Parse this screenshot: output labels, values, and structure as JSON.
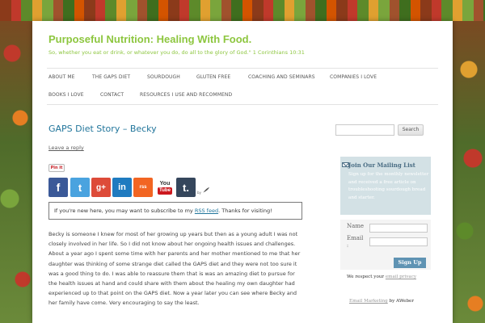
{
  "site": {
    "title": "Purposeful Nutrition: Healing With Food.",
    "description": "So, whether you eat or drink, or whatever you do, do all to the glory of God.\" 1 Corinthians 10:31"
  },
  "nav": {
    "items": [
      "ABOUT ME",
      "THE GAPS DIET",
      "SOURDOUGH",
      "GLUTEN FREE",
      "COACHING AND SEMINARS",
      "COMPANIES I LOVE",
      "BOOKS I LOVE",
      "CONTACT",
      "RESOURCES I USE AND RECOMMEND"
    ]
  },
  "post": {
    "title": "GAPS Diet Story – Becky",
    "leave_reply": "Leave a reply",
    "pinit": "Pin it",
    "notice_before": "If you're new here, you may want to subscribe to my ",
    "notice_link": "RSS feed",
    "notice_after": ". Thanks for visiting!",
    "body": "Becky is someone I knew for most of her growing up years but then as a young adult I was not closely involved in her life.   So I did not know about her ongoing health issues and challenges.  About a year ago I spent some time with her parents and her mother mentioned to me that her daughter was thinking of some strange diet called the GAPS diet and they were not too sure it was a good thing to do.  I was able to reassure them that is was an amazing diet to pursue for the health issues at hand and could share with them about the healing my own daughter had experienced up to that point on the GAPS diet.  Now a year later you can see where Becky and her family have come.  Very encouraging to say the least."
  },
  "social": {
    "facebook": "f",
    "twitter": "t",
    "googleplus": "g+",
    "linkedin": "in",
    "rss": "rss",
    "youtube_top": "You",
    "youtube_bottom": "Tube",
    "tumblr": "t.",
    "by": "by"
  },
  "sidebar": {
    "search_placeholder": "",
    "search_button": "Search",
    "mailing": {
      "title": "Join Our Mailing List",
      "text": "Sign up for the monthly newsletter and received a free article on troubleshooting sourdough bread and starter."
    },
    "form": {
      "name_label": "Name",
      "email_label": "Email",
      "colon": ":",
      "signup": "Sign Up"
    },
    "respect_text": "We respect your ",
    "privacy_link": "email privacy",
    "email_marketing_link": "Email Marketing",
    "by_aweber": " by AWeber"
  },
  "colors": {
    "title_green": "#8dc63f",
    "link_blue": "#21759b",
    "mailing_bg": "#d3e1e5",
    "signup_blue": "#5f93b3"
  }
}
